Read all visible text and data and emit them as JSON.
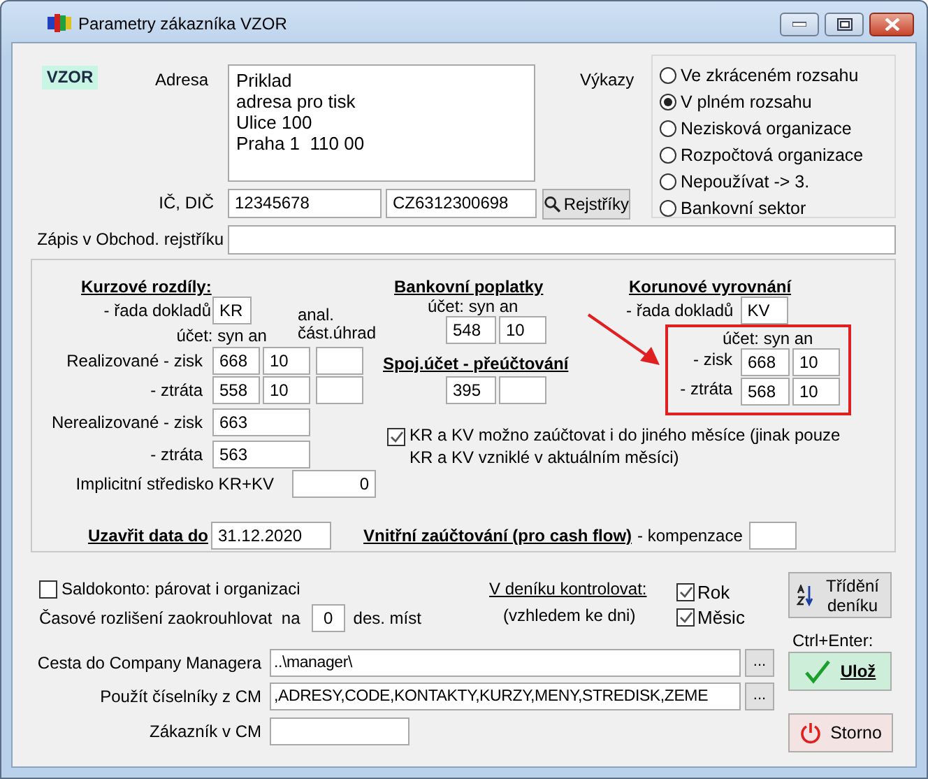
{
  "window": {
    "title": "Parametry zákazníka VZOR"
  },
  "code_badge": "VZOR",
  "address": {
    "label": "Adresa",
    "lines": [
      "Priklad",
      "adresa pro tisk",
      "Ulice 100",
      "Praha 1  110 00"
    ]
  },
  "reports": {
    "label": "Výkazy",
    "options": [
      {
        "label": "Ve zkráceném rozsahu",
        "selected": false
      },
      {
        "label": "V plném rozsahu",
        "selected": true
      },
      {
        "label": "Nezisková organizace",
        "selected": false
      },
      {
        "label": "Rozpočtová organizace",
        "selected": false
      },
      {
        "label": "Nepoužívat -> 3.",
        "selected": false
      },
      {
        "label": "Bankovní sektor",
        "selected": false
      }
    ]
  },
  "ids": {
    "label": "IČ, DIČ",
    "ic": "12345678",
    "dic": "CZ6312300698",
    "button": "Rejstříky"
  },
  "register": {
    "label": "Zápis v Obchod. rejstříku"
  },
  "exchange_differences": {
    "title": "Kurzové rozdíly:",
    "series_label": "- řada dokladů",
    "series": "KR",
    "account_header": "účet: syn an",
    "analytic_header": [
      "anal.",
      "část.úhrad"
    ],
    "rows": [
      {
        "label": "Realizované - zisk",
        "syn": "668",
        "an": "10",
        "kind": "full"
      },
      {
        "label": "- ztráta",
        "syn": "558",
        "an": "10",
        "kind": "full"
      },
      {
        "label": "Nerealizované - zisk",
        "syn": "663",
        "kind": "single"
      },
      {
        "label": "- ztráta",
        "syn": "563",
        "kind": "single"
      }
    ]
  },
  "default_center": {
    "label": "Implicitní středisko KR+KV",
    "value": "0"
  },
  "close_date": {
    "label": "Uzavřit data do",
    "value": "31.12.2020"
  },
  "bank_fees": {
    "title": "Bankovní poplatky",
    "account_header": "účet: syn an",
    "syn": "548",
    "an": "10"
  },
  "link_account": {
    "title": "Spoj.účet - přeúčtování",
    "syn": "395"
  },
  "rounding": {
    "title": "Korunové vyrovnání",
    "series_label": "- řada dokladů",
    "series": "KV",
    "account_header": "účet: syn an",
    "rows": [
      {
        "label": "- zisk",
        "syn": "668",
        "an": "10"
      },
      {
        "label": "- ztráta",
        "syn": "568",
        "an": "10"
      }
    ]
  },
  "other_month": {
    "lines": [
      "KR a KV možno zaúčtovat i do jiného měsíce (jinak pouze",
      "KR a KV vzniklé v aktuálním měsíci)"
    ],
    "checked": true
  },
  "internal_posting": {
    "title": "Vnitřní zaúčtování (pro cash flow)",
    "suffix": "- kompenzace"
  },
  "saldo": {
    "label": "Saldokonto: párovat i organizaci",
    "checked": false
  },
  "accrual_rounding": {
    "label": "Časové rozlišení zaokrouhlovat  na",
    "value": "0",
    "unit": "des. míst"
  },
  "journal_check": {
    "title": "V deníku kontrolovat:",
    "note": "(vzhledem ke dni)",
    "options": [
      {
        "label": "Rok",
        "checked": true
      },
      {
        "label": "Měsic",
        "checked": true
      }
    ]
  },
  "cm_path": {
    "label": "Cesta do Company Managera",
    "value": "..\\manager\\",
    "button": "..."
  },
  "cm_codebooks": {
    "label": "Použít číselníky z CM",
    "value": ",ADRESY,CODE,KONTAKTY,KURZY,MENY,STREDISK,ZEME",
    "button": "..."
  },
  "cm_customer": {
    "label": "Zákazník v CM"
  },
  "actions": {
    "sort": "Třídění deníku",
    "hint": "Ctrl+Enter:",
    "save": "Ulož",
    "cancel": "Storno"
  }
}
